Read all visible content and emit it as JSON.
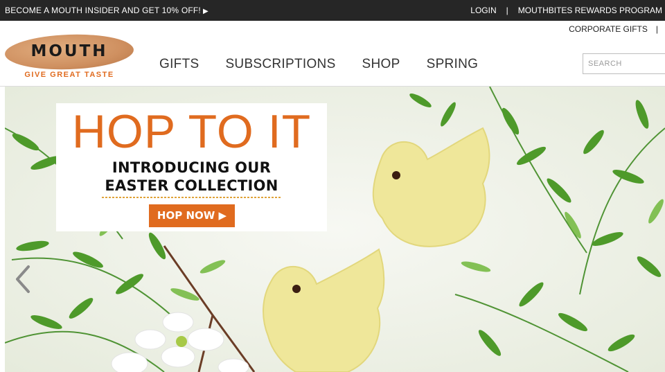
{
  "topbar": {
    "promo_text": "BECOME A MOUTH INSIDER AND GET 10% OFF!",
    "promo_icon": "play-triangle-icon",
    "login": "LOGIN",
    "separator": "|",
    "rewards": "MOUTHBITES REWARDS PROGRAM"
  },
  "header": {
    "corporate_gifts": "CORPORATE GIFTS",
    "separator": "|",
    "logo": {
      "wordmark": "MOUTH",
      "tagline": "GIVE GREAT TASTE"
    },
    "nav": [
      "GIFTS",
      "SUBSCRIPTIONS",
      "SHOP",
      "SPRING"
    ],
    "search_placeholder": "SEARCH"
  },
  "hero": {
    "title": "HOP TO IT",
    "subtitle_line1": "INTRODUCING OUR",
    "subtitle_line2": "EASTER COLLECTION",
    "cta": "HOP NOW ▶",
    "prev_icon": "chevron-left-icon",
    "colors": {
      "accent": "#e06b1f",
      "topbar": "#262626",
      "chick": "#efe79a"
    }
  }
}
